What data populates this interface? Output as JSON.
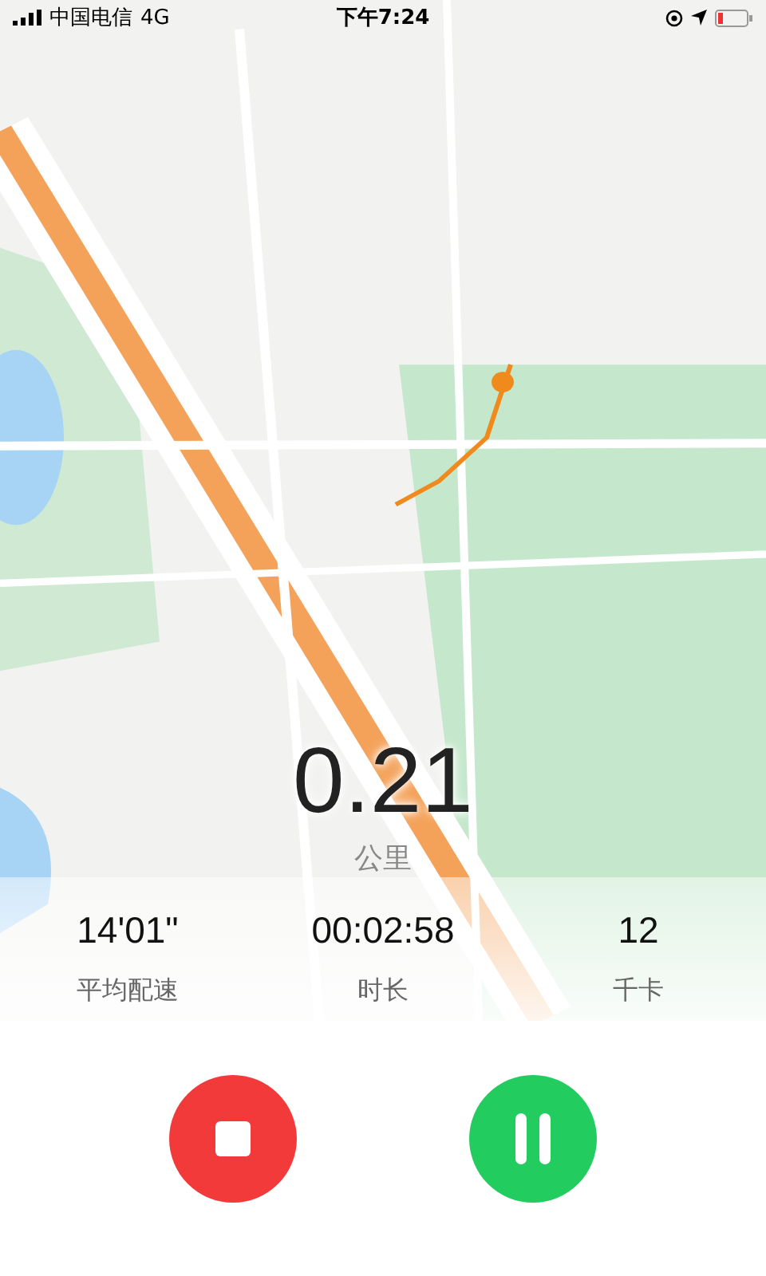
{
  "status_bar": {
    "carrier": "中国电信",
    "network": "4G",
    "time": "下午7:24"
  },
  "distance": {
    "value": "0.21",
    "unit": "公里"
  },
  "stats": [
    {
      "value": "14'01\"",
      "label": "平均配速"
    },
    {
      "value": "00:02:58",
      "label": "时长"
    },
    {
      "value": "12",
      "label": "千卡"
    }
  ],
  "controls": [
    {
      "kind": "stop"
    },
    {
      "kind": "pause"
    }
  ]
}
